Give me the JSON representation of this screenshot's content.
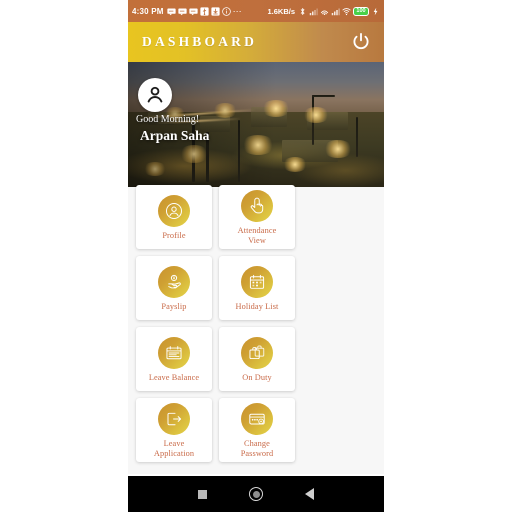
{
  "status_bar": {
    "time": "4:30 PM",
    "network_speed": "1.6KB/s",
    "battery_level": "100",
    "left_icons": [
      "message-icon",
      "message-icon",
      "message-icon",
      "usb-icon",
      "download-icon",
      "info-icon",
      "overflow-dots-icon"
    ],
    "right_icons": [
      "bluetooth-icon",
      "signal-bars-icon",
      "alarm-icon",
      "signal-bars-icon",
      "wifi-icon",
      "battery-icon",
      "charging-bolt-icon"
    ]
  },
  "app_bar": {
    "title": "DASHBOARD",
    "power_icon": "power-icon"
  },
  "banner": {
    "avatar_icon": "user-avatar-icon",
    "greeting": "Good Morning!",
    "user_name": "Arpan Saha"
  },
  "grid": {
    "items": [
      {
        "label": "Profile",
        "icon": "profile-icon"
      },
      {
        "label": "Attendance\nView",
        "icon": "fingerprint-touch-icon"
      },
      {
        "label": "Payslip",
        "icon": "hand-money-icon"
      },
      {
        "label": "Holiday List",
        "icon": "calendar-icon"
      },
      {
        "label": "Leave Balance",
        "icon": "calendar-balance-icon"
      },
      {
        "label": "On Duty",
        "icon": "briefcase-icon"
      },
      {
        "label": "Leave\nApplication",
        "icon": "exit-arrow-icon"
      },
      {
        "label": "Change\nPassword",
        "icon": "password-card-icon"
      }
    ]
  },
  "nav_bar": {
    "recents_label": "recents-square-icon",
    "home_label": "home-circle-icon",
    "back_label": "back-triangle-icon"
  },
  "colors": {
    "accent_gold": "#d8b43a",
    "label_text": "#c96b49",
    "status_bar_bg": "#bf6f3d",
    "content_bg": "#f7f7f7"
  }
}
